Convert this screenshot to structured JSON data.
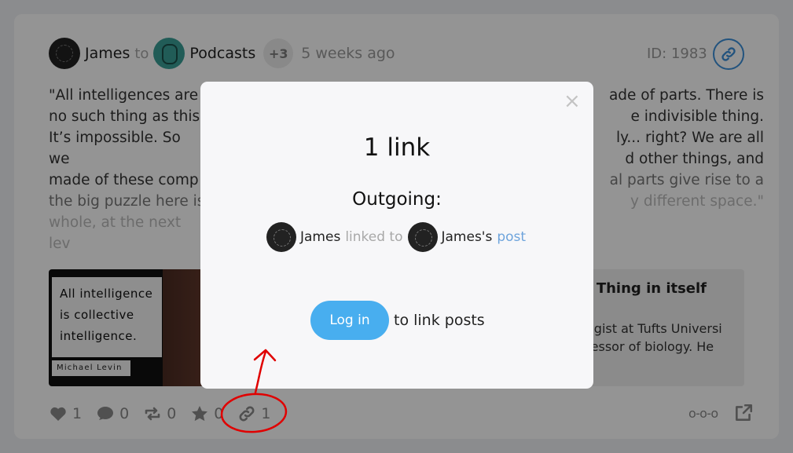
{
  "post": {
    "author": "James",
    "to_word": "to",
    "community": "Podcasts",
    "extra_count": "+3",
    "time_ago": "5 weeks ago",
    "id_label": "ID: 1983",
    "text_lines": [
      "\"All intelligences are",
      "no such thing as this,",
      "It’s impossible. So we",
      "made of these comp",
      "the big puzzle here is"
    ],
    "text_lines_right": [
      "ade of parts. There is",
      "e indivisible thing.",
      "ly... right? We are all",
      "d other things, and",
      "al parts give rise to a"
    ],
    "faded_line_left": "whole, at the next lev",
    "faded_line_right": "y different space.\"",
    "image_quote": [
      "All intelligence",
      "is collective",
      "intelligence."
    ],
    "image_signature": "Michael Levin",
    "preview_title": "| Thing in itself",
    "preview_desc": [
      "ogist at Tufts Universi",
      "fessor of biology. He"
    ]
  },
  "actions": {
    "likes": "1",
    "comments": "0",
    "reposts": "0",
    "stars": "0",
    "links": "1",
    "chain_glyph": "o-o-o"
  },
  "modal": {
    "close_glyph": "×",
    "title": "1 link",
    "section_label": "Outgoing:",
    "link": {
      "from": "James",
      "verb": "linked to",
      "to": "James's",
      "target": "post"
    },
    "login_label": "Log in",
    "login_suffix": "to link posts"
  },
  "colors": {
    "accent": "#48aeef",
    "link_blue": "#3b8fd9",
    "annotation_red": "#e00000"
  },
  "icons": {
    "header_link": "link-icon",
    "like": "heart-icon",
    "comment": "comment-icon",
    "repost": "repost-icon",
    "star": "star-icon",
    "link": "link-icon",
    "external": "external-link-icon"
  }
}
